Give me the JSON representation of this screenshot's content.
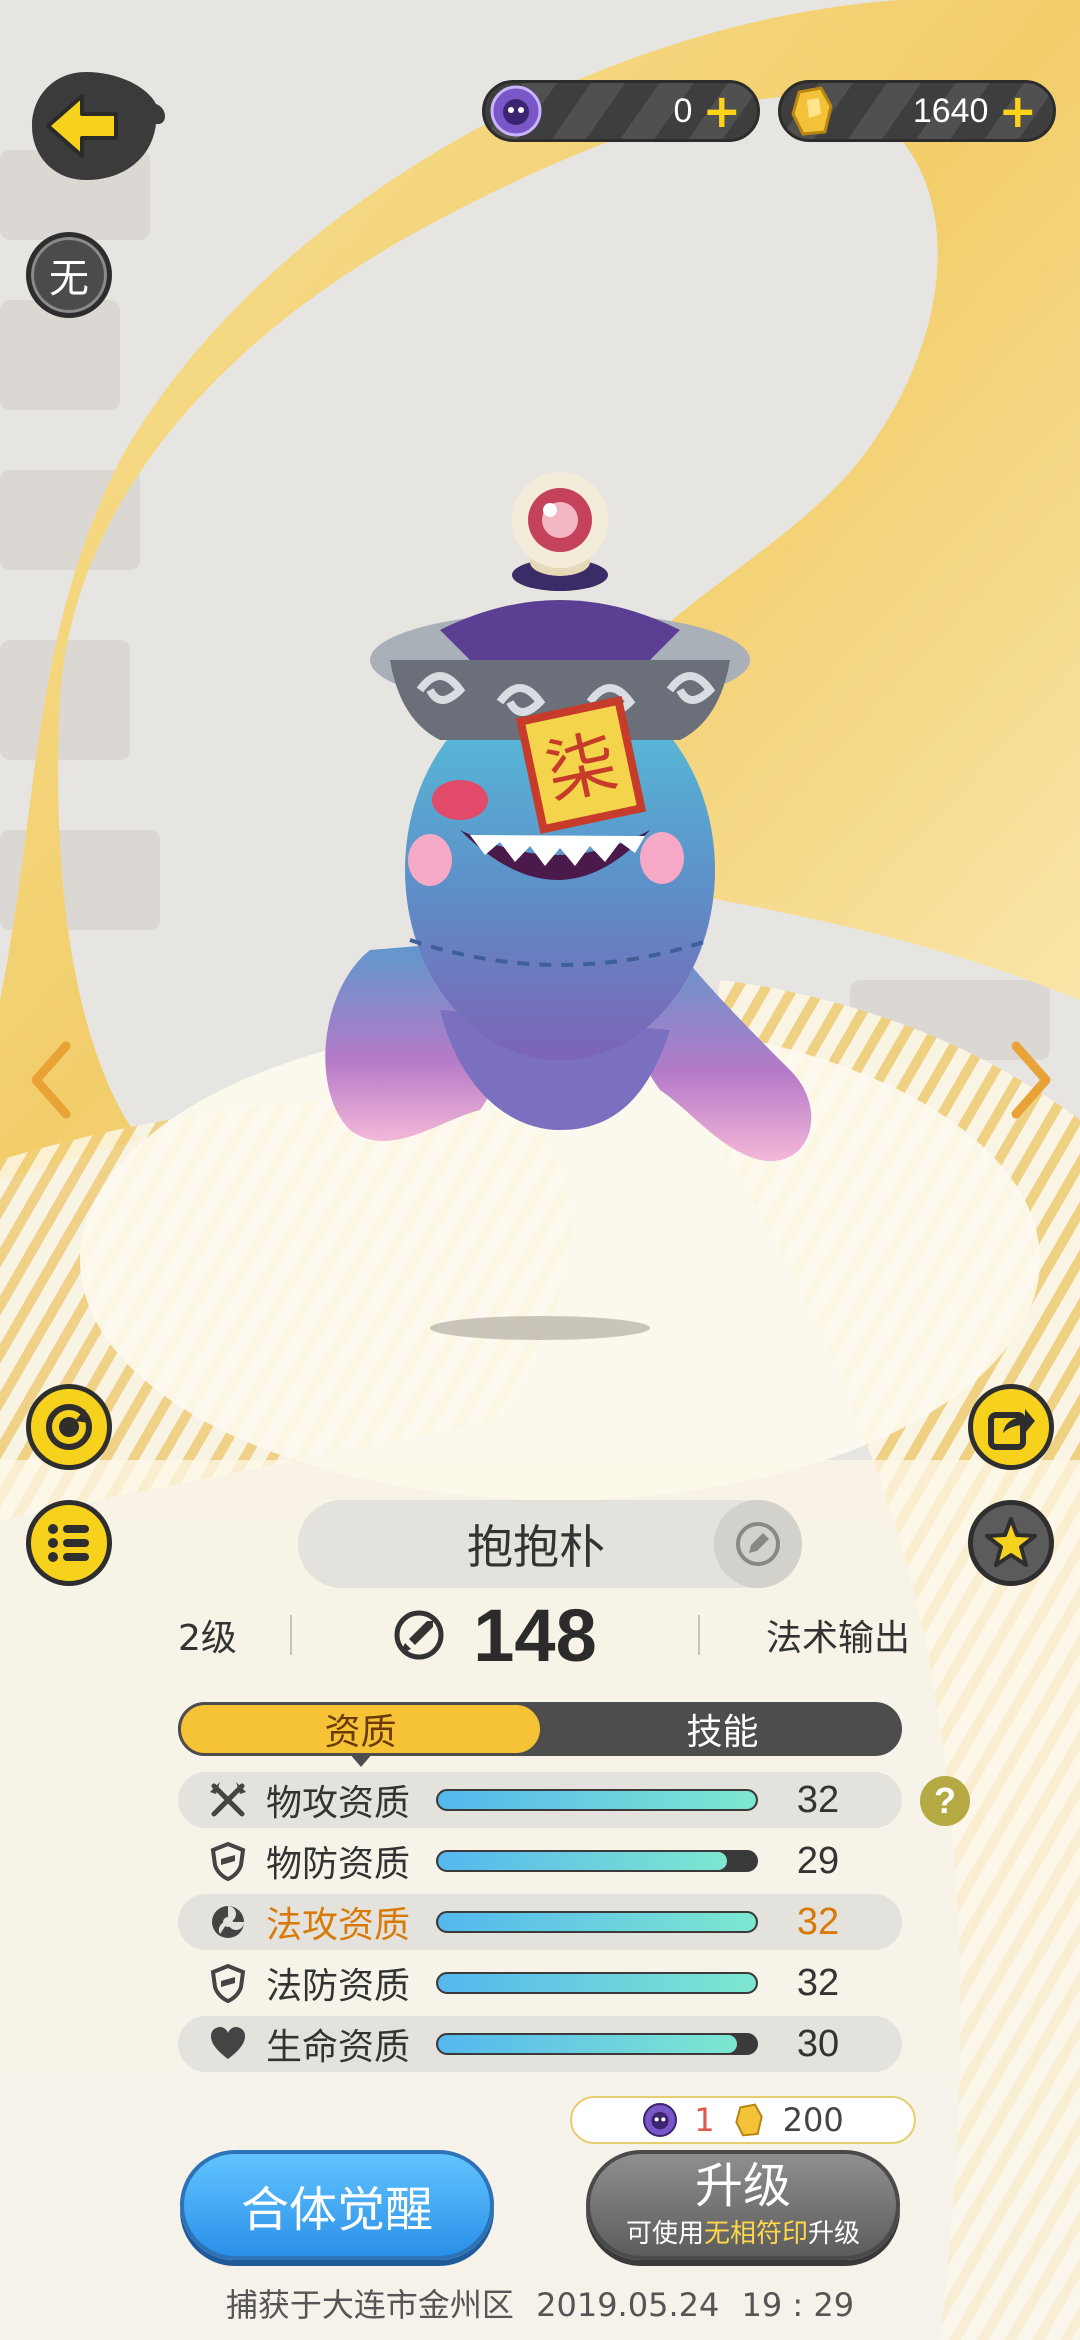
{
  "currencies": {
    "orb": {
      "value": "0",
      "plus": "+",
      "icon": "ghost-orb-icon"
    },
    "crystal": {
      "value": "1640",
      "plus": "+",
      "icon": "crystal-icon"
    }
  },
  "badge": {
    "label": "无"
  },
  "monster": {
    "name": "抱抱朴",
    "seal_text": "柒"
  },
  "info": {
    "level": "2级",
    "power": "148",
    "role": "法术输出"
  },
  "tabs": [
    {
      "label": "资质",
      "active": true
    },
    {
      "label": "技能",
      "active": false
    }
  ],
  "stats": [
    {
      "label": "物攻资质",
      "value": "32",
      "fill": 1.0,
      "icon": "physical-attack-icon",
      "highlight": false
    },
    {
      "label": "物防资质",
      "value": "29",
      "fill": 0.91,
      "icon": "physical-defense-icon",
      "highlight": false
    },
    {
      "label": "法攻资质",
      "value": "32",
      "fill": 1.0,
      "icon": "magic-attack-icon",
      "highlight": true
    },
    {
      "label": "法防资质",
      "value": "32",
      "fill": 1.0,
      "icon": "magic-defense-icon",
      "highlight": false
    },
    {
      "label": "生命资质",
      "value": "30",
      "fill": 0.94,
      "icon": "heart-icon",
      "highlight": false
    }
  ],
  "help": {
    "label": "?"
  },
  "cost": {
    "orb": "1",
    "crystal": "200"
  },
  "buttons": {
    "awaken": "合体觉醒",
    "upgrade": "升级",
    "upgrade_sub_prefix": "可使用",
    "upgrade_sub_item": "无相符印",
    "upgrade_sub_suffix": "升级"
  },
  "footer": {
    "text": "捕获于大连市金州区",
    "date": "2019.05.24",
    "time": "19 : 29"
  },
  "colors": {
    "accent_yellow": "#f6d21c",
    "tab_active": "#f6c236",
    "highlight_orange": "#d97a08",
    "awaken_blue": "#2a90e8"
  }
}
